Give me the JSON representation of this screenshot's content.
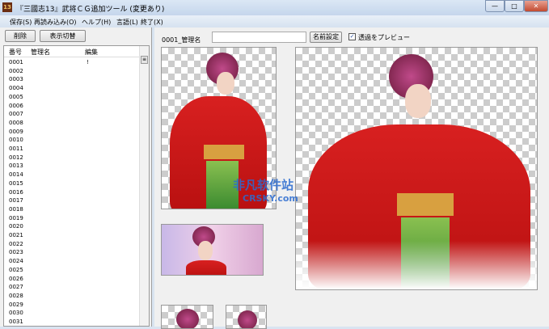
{
  "window": {
    "icon_text": "13",
    "title": "『三國志13』武将ＣＧ追加ツール (変更あり)",
    "minimize": "—",
    "maximize": "□",
    "close": "✕"
  },
  "menu": [
    "保存(S)",
    "再読み込み(O)",
    "ヘルプ(H)",
    "言語(L)",
    "終了(X)"
  ],
  "left": {
    "delete_button": "削除",
    "toggle_button": "表示切替",
    "columns": [
      "番号",
      "管理名",
      "編集"
    ],
    "rows": [
      {
        "id": "0001",
        "edit": "!"
      },
      {
        "id": "0002"
      },
      {
        "id": "0003"
      },
      {
        "id": "0004"
      },
      {
        "id": "0005"
      },
      {
        "id": "0006"
      },
      {
        "id": "0007"
      },
      {
        "id": "0008"
      },
      {
        "id": "0009"
      },
      {
        "id": "0010"
      },
      {
        "id": "0011"
      },
      {
        "id": "0012"
      },
      {
        "id": "0013"
      },
      {
        "id": "0014"
      },
      {
        "id": "0015"
      },
      {
        "id": "0016"
      },
      {
        "id": "0017"
      },
      {
        "id": "0018"
      },
      {
        "id": "0019"
      },
      {
        "id": "0020"
      },
      {
        "id": "0021"
      },
      {
        "id": "0022"
      },
      {
        "id": "0023"
      },
      {
        "id": "0024"
      },
      {
        "id": "0025"
      },
      {
        "id": "0026"
      },
      {
        "id": "0027"
      },
      {
        "id": "0028"
      },
      {
        "id": "0029"
      },
      {
        "id": "0030"
      },
      {
        "id": "0031"
      }
    ]
  },
  "right": {
    "name_label": "0001_管理名",
    "name_value": "",
    "set_name_button": "名前設定",
    "preview_checkbox_label": "透過をプレビュー",
    "preview_checked": true
  },
  "watermark": {
    "line1": "非凡软件站",
    "line2": "CRSKY.com"
  }
}
